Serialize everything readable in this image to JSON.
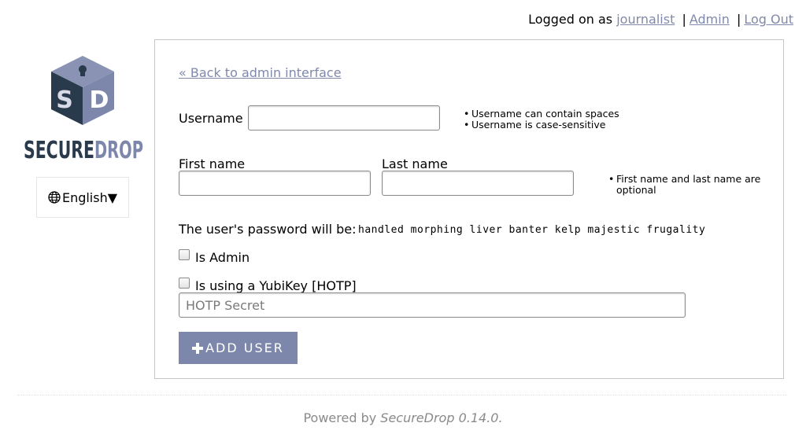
{
  "header": {
    "logged_on_as": "Logged on as",
    "username": "journalist",
    "separator": "|",
    "admin_link": "Admin",
    "logout_link": "Log Out"
  },
  "logo": {
    "text_primary": "SECURE",
    "text_secondary": "DROP",
    "cube_letter_left": "S",
    "cube_letter_right": "D"
  },
  "language": {
    "icon": "globe-icon",
    "selected": "English▼"
  },
  "form": {
    "back_link": "« Back to admin interface",
    "username_label": "Username",
    "username_value": "",
    "username_hints": [
      "Username can contain spaces",
      "Username is case-sensitive"
    ],
    "first_name_label": "First name",
    "first_name_value": "",
    "last_name_label": "Last name",
    "last_name_value": "",
    "name_hint": "First name and last name are optional",
    "password_label": "The user's password will be:",
    "password_value": "handled morphing liver banter kelp majestic frugality",
    "is_admin_label": "Is Admin",
    "is_admin_checked": false,
    "yubikey_label": "Is using a YubiKey [HOTP]",
    "yubikey_checked": false,
    "hotp_placeholder": "HOTP Secret",
    "submit_icon": "plus-icon",
    "submit_label": "ADD USER"
  },
  "footer": {
    "powered_by": "Powered by",
    "product": "SecureDrop 0.14.0."
  },
  "colors": {
    "accent": "#7c87ab",
    "link": "#8089ab",
    "logo_dark": "#2a3a4d",
    "logo_light": "#7c87ab"
  }
}
